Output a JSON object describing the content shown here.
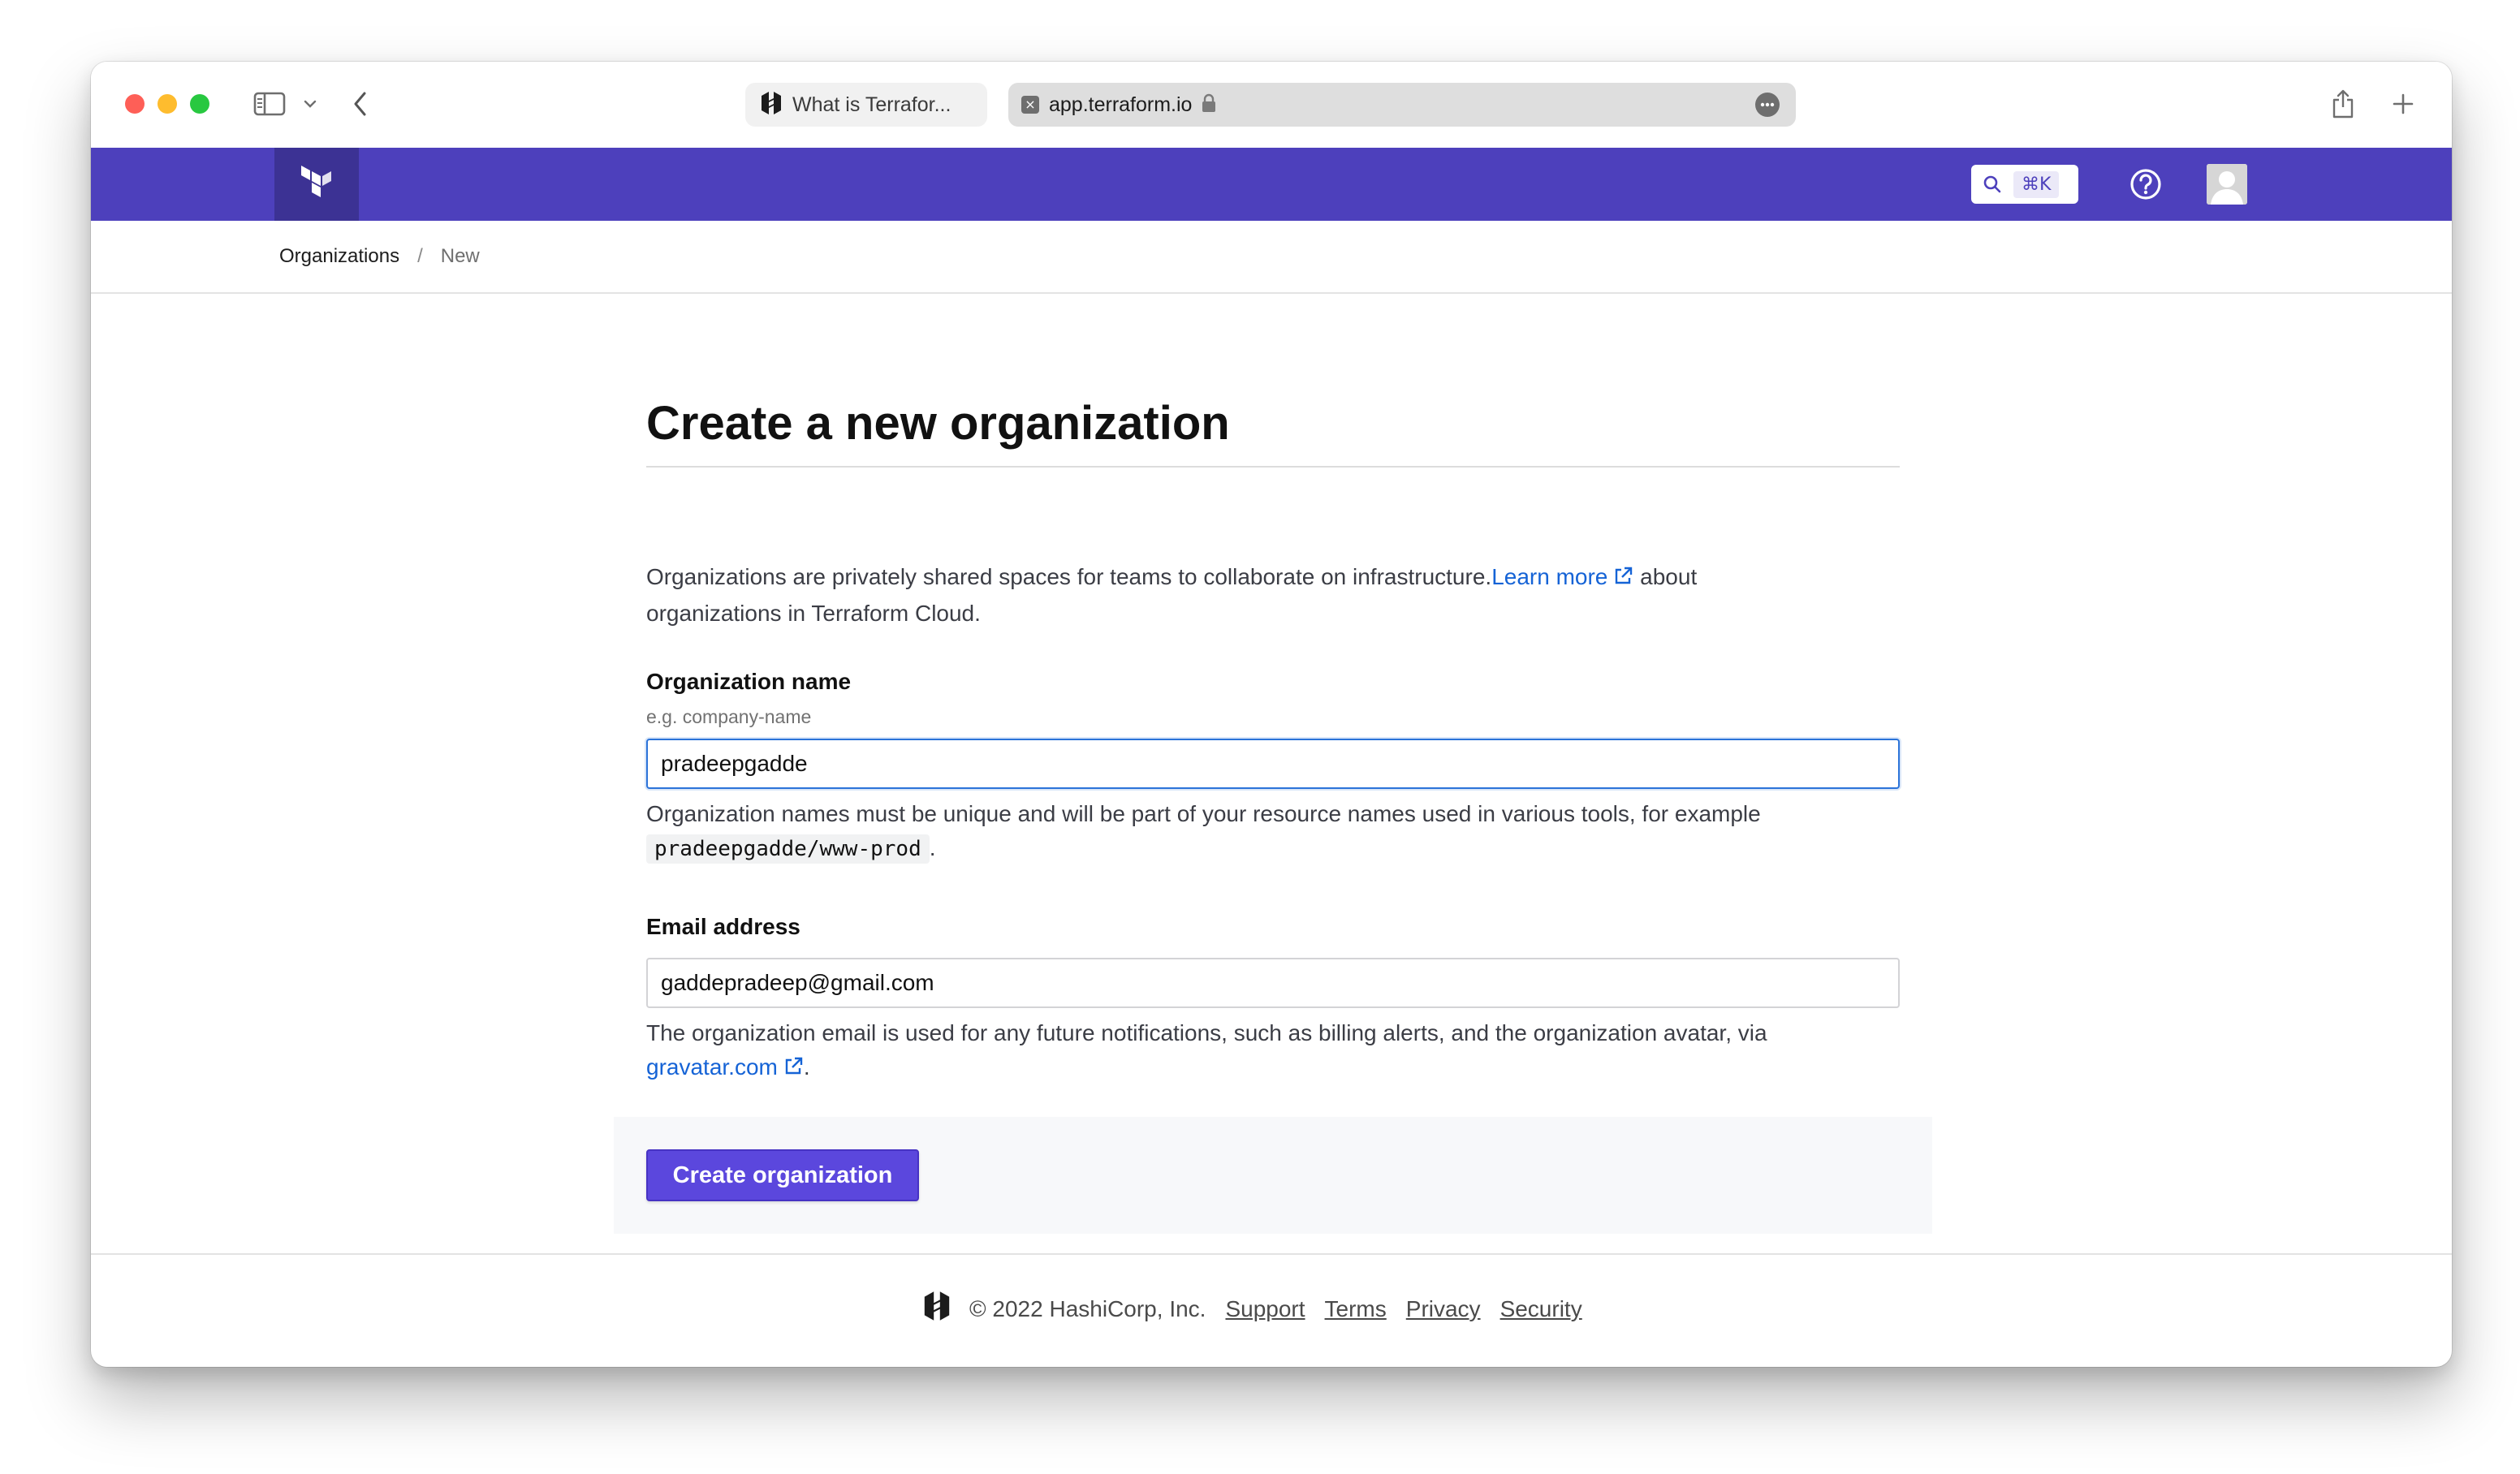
{
  "browser": {
    "tabs": [
      {
        "title": "What is Terrafor...",
        "active": false
      },
      {
        "title": "app.terraform.io",
        "active": true
      }
    ]
  },
  "header": {
    "search_shortcut": "⌘K",
    "brand_color": "#4d40bc"
  },
  "breadcrumb": {
    "items": [
      "Organizations",
      "New"
    ],
    "separator": "/"
  },
  "form": {
    "title": "Create a new organization",
    "intro_text": "Organizations are privately shared spaces for teams to collaborate on infrastructure.",
    "intro_link": "Learn more",
    "intro_tail": "about organizations in Terraform Cloud.",
    "org_name": {
      "label": "Organization name",
      "hint": "e.g. company-name",
      "value": "pradeepgadde",
      "help_text": "Organization names must be unique and will be part of your resource names used in various tools, for example",
      "example_code": "pradeepgadde/www-prod",
      "help_tail": "."
    },
    "email": {
      "label": "Email address",
      "value": "gaddepradeep@gmail.com",
      "help_text": "The organization email is used for any future notifications, such as billing alerts, and the organization avatar, via",
      "help_link": "gravatar.com",
      "help_tail": "."
    },
    "submit_label": "Create organization",
    "accent_color": "#5b47dd"
  },
  "footer": {
    "copyright": "© 2022 HashiCorp, Inc.",
    "links": [
      "Support",
      "Terms",
      "Privacy",
      "Security"
    ]
  }
}
